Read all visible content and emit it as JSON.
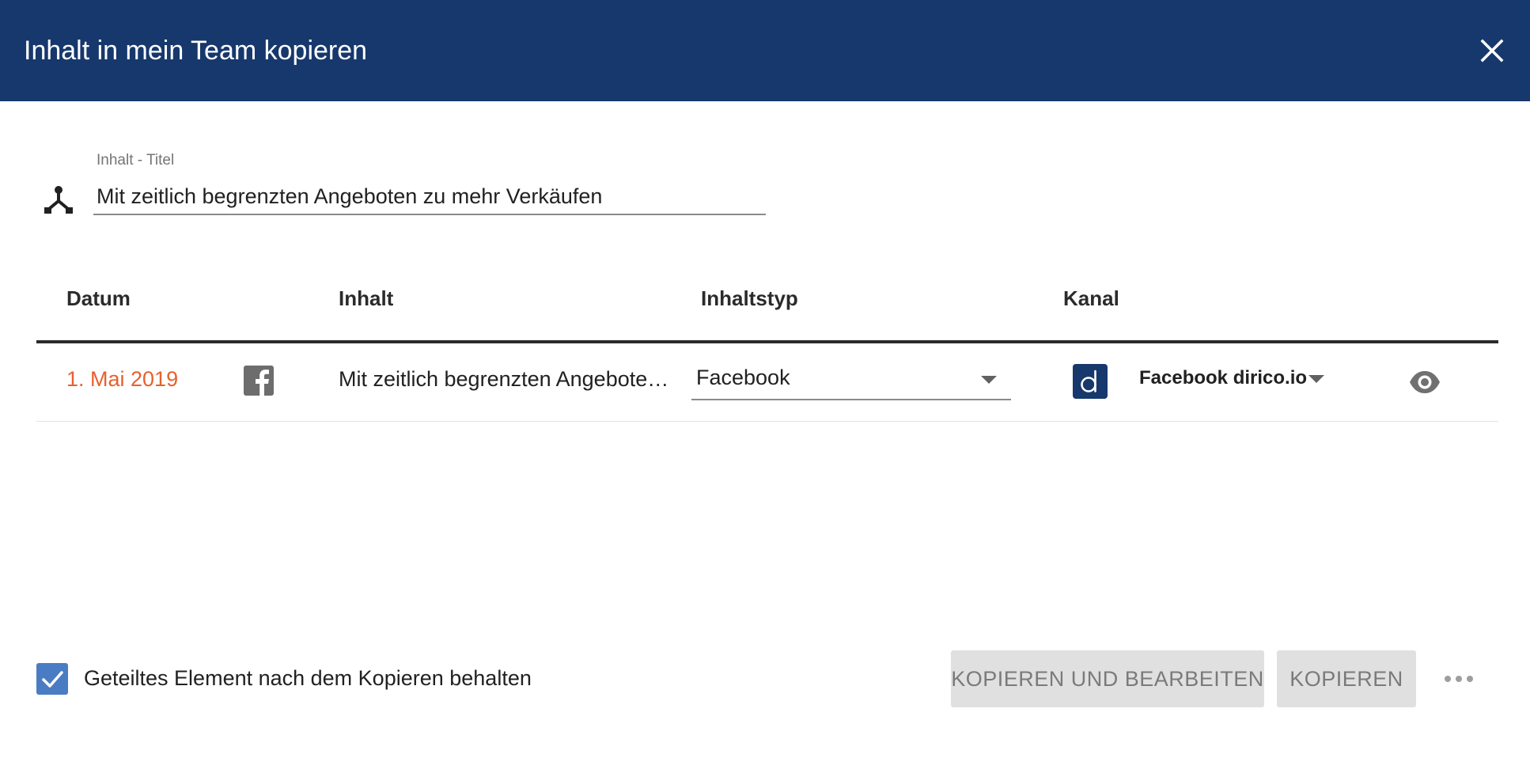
{
  "header": {
    "title": "Inhalt in mein Team kopieren",
    "close_icon": "close-icon"
  },
  "title_field": {
    "icon": "call-split-icon",
    "label": "Inhalt - Titel",
    "value": "Mit zeitlich begrenzten Angeboten zu mehr Verkäufen"
  },
  "table": {
    "columns": [
      "Datum",
      "Inhalt",
      "Inhaltstyp",
      "Kanal"
    ],
    "rows": [
      {
        "date": "1. Mai 2019",
        "network_icon": "facebook-icon",
        "content": "Mit zeitlich begrenzten Angeboten zu mehr Verkäufen",
        "content_type": "Facebook",
        "channel_avatar": "dirico-logo-icon",
        "channel": "Facebook dirico.io",
        "action_icon": "eye-icon"
      }
    ]
  },
  "footer": {
    "checkbox_checked": true,
    "checkbox_label": "Geteiltes Element nach dem Kopieren behalten",
    "copy_edit_label": "KOPIEREN UND BEARBEITEN",
    "copy_label": "KOPIEREN",
    "more_icon": "more-horizontal-icon"
  },
  "colors": {
    "header_bg": "#16386c",
    "date_accent": "#e8602c",
    "checkbox": "#4a7cc4",
    "button_bg": "#e0e0e0"
  }
}
